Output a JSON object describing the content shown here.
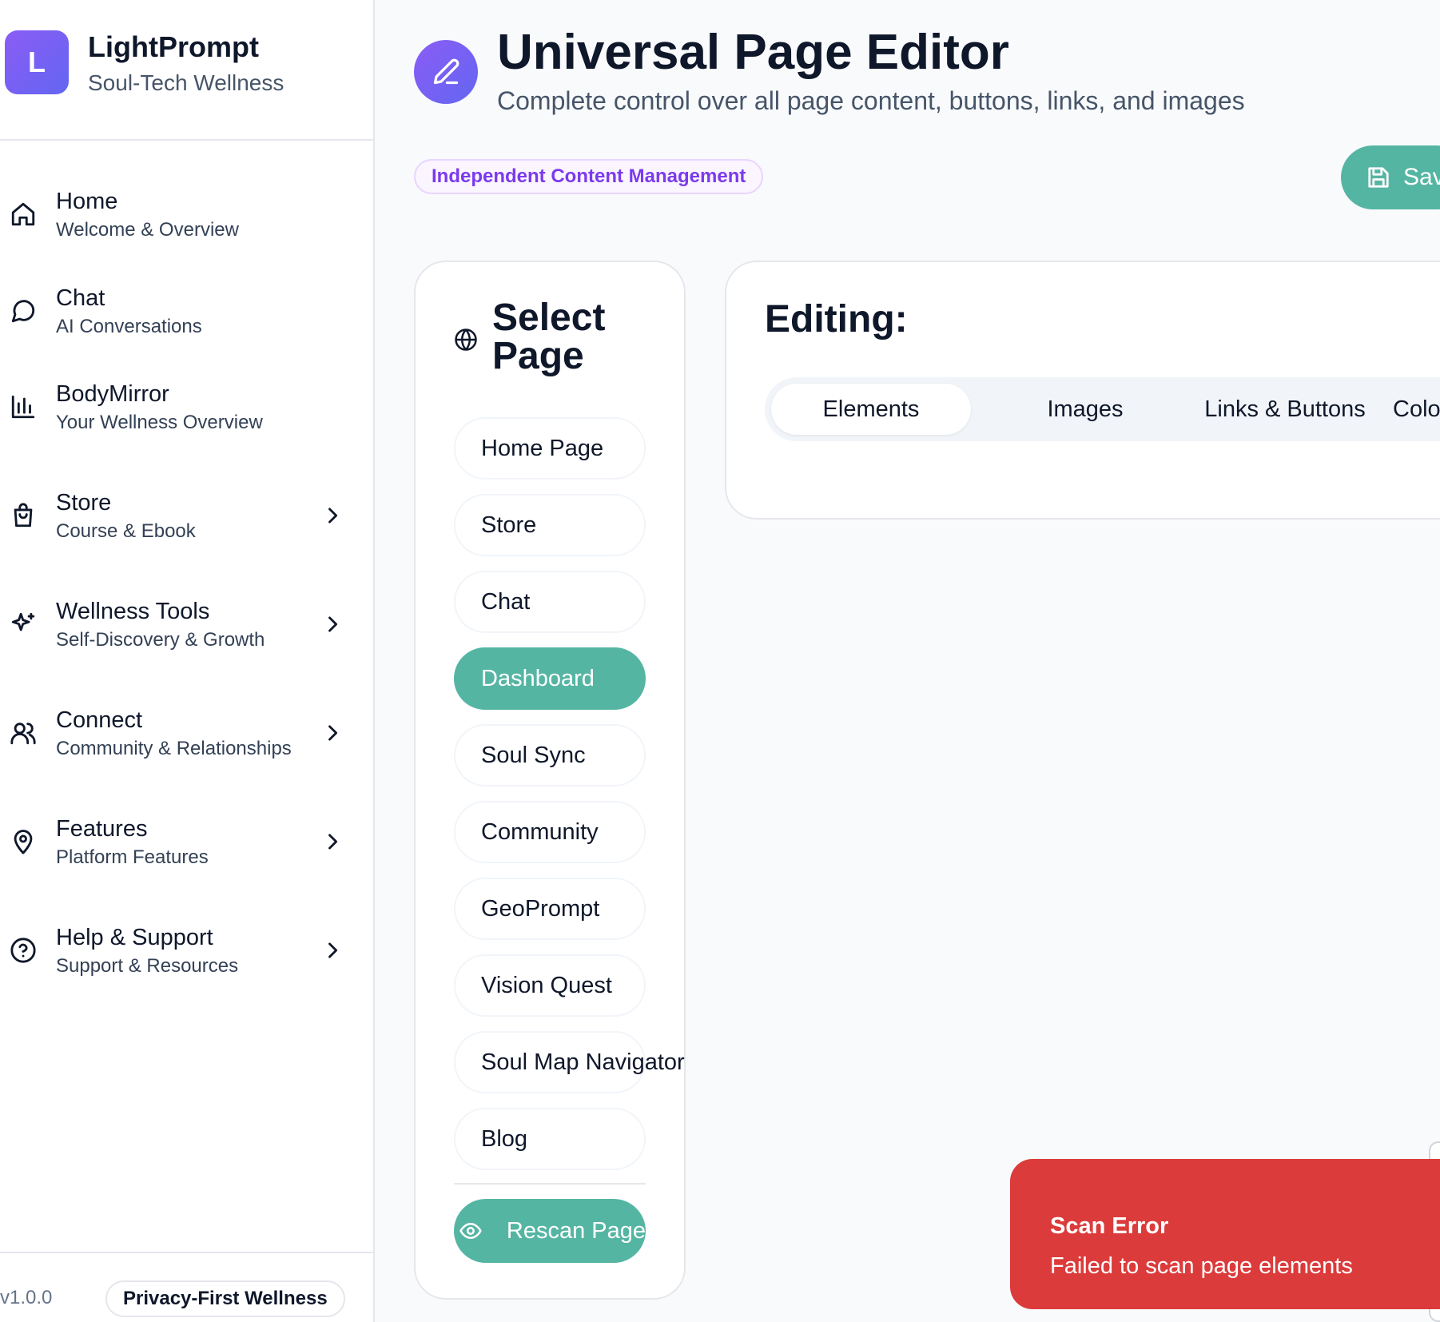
{
  "brand": {
    "logo_letter": "L",
    "name": "LightPrompt",
    "tagline": "Soul-Tech Wellness",
    "accent": "#8b5cf6"
  },
  "sidebar": {
    "items": [
      {
        "title": "Home",
        "subtitle": "Welcome & Overview",
        "icon": "home-icon",
        "has_chevron": false
      },
      {
        "title": "Chat",
        "subtitle": "AI Conversations",
        "icon": "chat-bubble-icon",
        "has_chevron": false
      },
      {
        "title": "BodyMirror",
        "subtitle": "Your Wellness Overview",
        "icon": "bar-chart-icon",
        "has_chevron": false
      },
      {
        "title": "Store",
        "subtitle": "Course & Ebook",
        "icon": "shopping-bag-icon",
        "has_chevron": true
      },
      {
        "title": "Wellness Tools",
        "subtitle": "Self-Discovery & Growth",
        "icon": "sparkles-icon",
        "has_chevron": true
      },
      {
        "title": "Connect",
        "subtitle": "Community & Relationships",
        "icon": "users-icon",
        "has_chevron": true
      },
      {
        "title": "Features",
        "subtitle": "Platform Features",
        "icon": "map-pin-icon",
        "has_chevron": true
      },
      {
        "title": "Help & Support",
        "subtitle": "Support & Resources",
        "icon": "help-circle-icon",
        "has_chevron": true
      }
    ],
    "footer": {
      "version": "v1.0.0",
      "badge": "Privacy-First Wellness"
    }
  },
  "header": {
    "title": "Universal Page Editor",
    "subtitle": "Complete control over all page content, buttons, links, and images",
    "badge": "Independent Content Management",
    "save_label": "Save"
  },
  "select_page": {
    "title": "Select Page",
    "pages": [
      "Home Page",
      "Store",
      "Chat",
      "Dashboard",
      "Soul Sync",
      "Community",
      "GeoPrompt",
      "Vision Quest",
      "Soul Map Navigator",
      "Blog"
    ],
    "selected": "Dashboard",
    "rescan_label": "Rescan Page"
  },
  "editor": {
    "title": "Editing:",
    "tabs": [
      "Elements",
      "Images",
      "Links & Buttons",
      "Colors"
    ],
    "active_tab": "Elements"
  },
  "toast": {
    "title": "Scan Error",
    "message": "Failed to scan page elements",
    "color": "#dc3b3b"
  },
  "colors": {
    "teal": "#55b5a3",
    "purple": "#7c3aed"
  }
}
